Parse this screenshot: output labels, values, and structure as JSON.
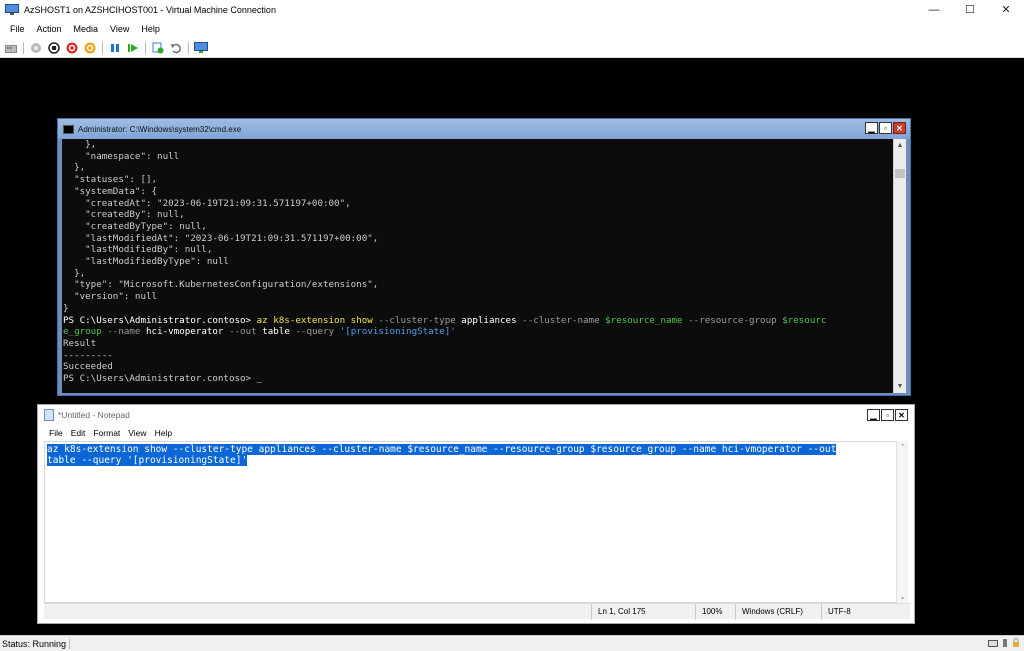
{
  "window": {
    "title": "AzSHOST1 on AZSHCIHOST001 - Virtual Machine Connection",
    "controls": {
      "minimize": "—",
      "maximize": "☐",
      "close": "✕"
    }
  },
  "menu": [
    "File",
    "Action",
    "Media",
    "View",
    "Help"
  ],
  "toolbar": {
    "icons": [
      "ctrl-alt-del-icon",
      "start-icon",
      "turn-off-icon",
      "shut-down-icon",
      "save-icon",
      "pause-icon",
      "resume-icon",
      "checkpoint-icon",
      "revert-icon",
      "enhanced-session-icon"
    ]
  },
  "status": {
    "text": "Status: Running"
  },
  "cmd": {
    "title": "Administrator: C:\\Windows\\system32\\cmd.exe",
    "output_lines": [
      "    },",
      "    \"namespace\": null",
      "  },",
      "  \"statuses\": [],",
      "  \"systemData\": {",
      "    \"createdAt\": \"2023-06-19T21:09:31.571197+00:00\",",
      "    \"createdBy\": null,",
      "    \"createdByType\": null,",
      "    \"lastModifiedAt\": \"2023-06-19T21:09:31.571197+00:00\",",
      "    \"lastModifiedBy\": null,",
      "    \"lastModifiedByType\": null",
      "  },",
      "  \"type\": \"Microsoft.KubernetesConfiguration/extensions\",",
      "  \"version\": null",
      "}"
    ],
    "prompt": "PS C:\\Users\\Administrator.contoso> ",
    "cmd_az": "az k8s-extension show",
    "flag_cluster_type": " --cluster-type",
    "val_appliances": " appliances",
    "flag_cluster_name": " --cluster-name",
    "var_resource_name": " $resource_name",
    "flag_resource_group": " --resource-group",
    "var_resource_group_1": " $resourc",
    "var_resource_group_2": "e_group",
    "flag_name": " --name",
    "val_name": " hci-vmoperator",
    "flag_out": " --out",
    "val_out": " table",
    "flag_query": " --query",
    "val_query": " '[provisioningState]'",
    "result_header": "Result",
    "result_sep": "---------",
    "result_value": "Succeeded",
    "cursor": "_"
  },
  "notepad": {
    "title": "*Untitled - Notepad",
    "menu": [
      "File",
      "Edit",
      "Format",
      "View",
      "Help"
    ],
    "line1": "az k8s-extension show --cluster-type appliances --cluster-name $resource_name --resource-group $resource_group --name hci-vmoperator --out",
    "line2": "table --query '[provisioningState]'",
    "status": {
      "position": "Ln 1, Col 175",
      "zoom": "100%",
      "line_ending": "Windows (CRLF)",
      "encoding": "UTF-8"
    }
  },
  "colors": {
    "cmd_background": "#0c0c0c",
    "cmd_text": "#cccccc",
    "cmd_command": "#f2e34a",
    "cmd_flag": "#9a9a9a",
    "cmd_variable": "#49c649",
    "cmd_string": "#4f9ee8",
    "selection": "#0b67d6"
  }
}
